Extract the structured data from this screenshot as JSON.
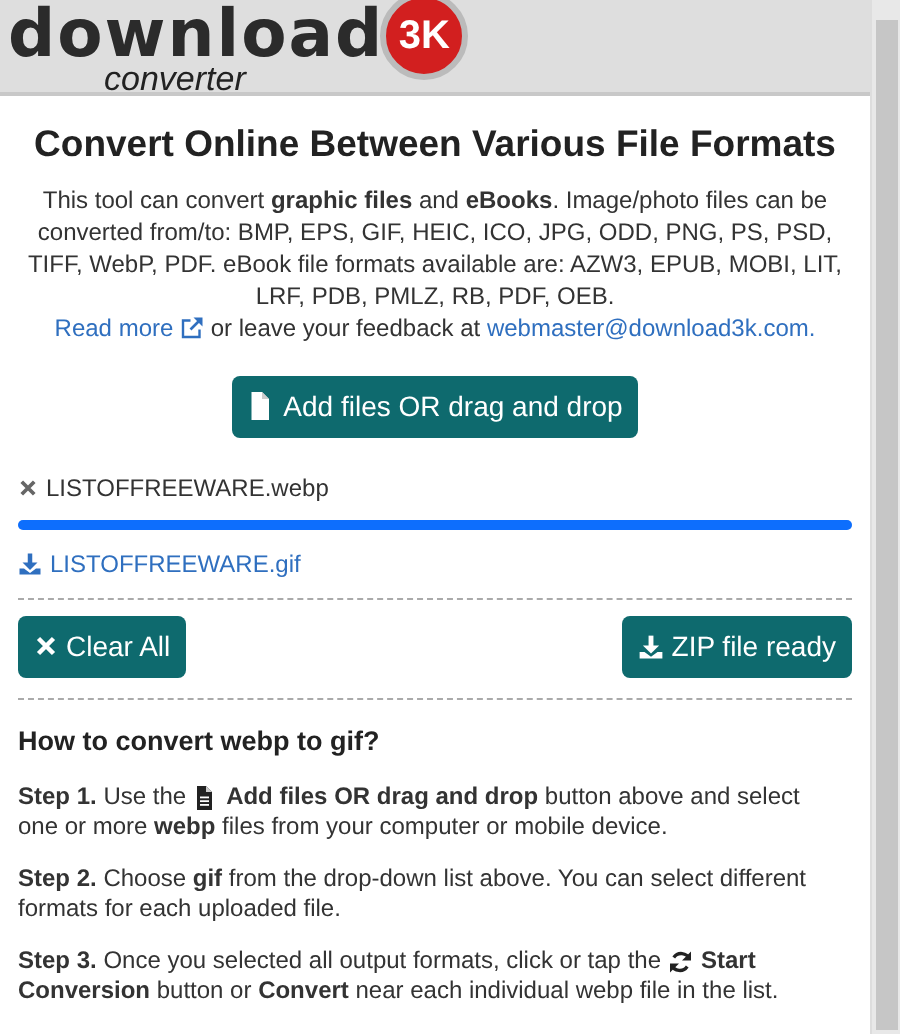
{
  "logo": {
    "word": "download",
    "badge": "3K",
    "tagline": "converter"
  },
  "title": "Convert Online Between Various File Formats",
  "intro": "This tool can convert **graphic files** and **eBooks**. Image/photo files can be converted from/to: BMP, EPS, GIF, HEIC, ICO, JPG, ODD, PNG, PS, PSD, TIFF, WebP, PDF. eBook file formats available are: AZW3, EPUB, MOBI, LIT, LRF, PDB, PMLZ, RB, PDF, OEB.",
  "read_more": "Read more",
  "feedback_text": "or leave your feedback at",
  "email": "webmaster@download3k.com.",
  "add_button": "Add files OR drag and drop",
  "upload": {
    "filename": "LISTOFFREEWARE.webp",
    "level": 1.0,
    "result": "LISTOFFREEWARE.gif"
  },
  "clear_button": "Clear All",
  "zip_button": "ZIP file ready",
  "howto_title": "How to convert webp to gif?",
  "steps": [
    {
      "lines": [
        {
          "before": "**Step 1.** Use the",
          "kind": "add",
          "after": "**Add files OR drag and drop** button above and select"
        },
        {
          "before": "one or more **webp** files from your computer or mobile device."
        }
      ]
    },
    {
      "lines": [
        {
          "before": "**Step 2.** Choose **gif** from the drop-down list above. You can select different"
        },
        {
          "before": "formats for each uploaded file."
        }
      ]
    },
    {
      "lines": [
        {
          "before": "**Step 3.** Once you selected all output formats, click or tap the",
          "kind": "convert",
          "after": "**Start**"
        },
        {
          "before": "**Conversion** button or **Convert** near each individual webp file in the list."
        }
      ]
    }
  ]
}
